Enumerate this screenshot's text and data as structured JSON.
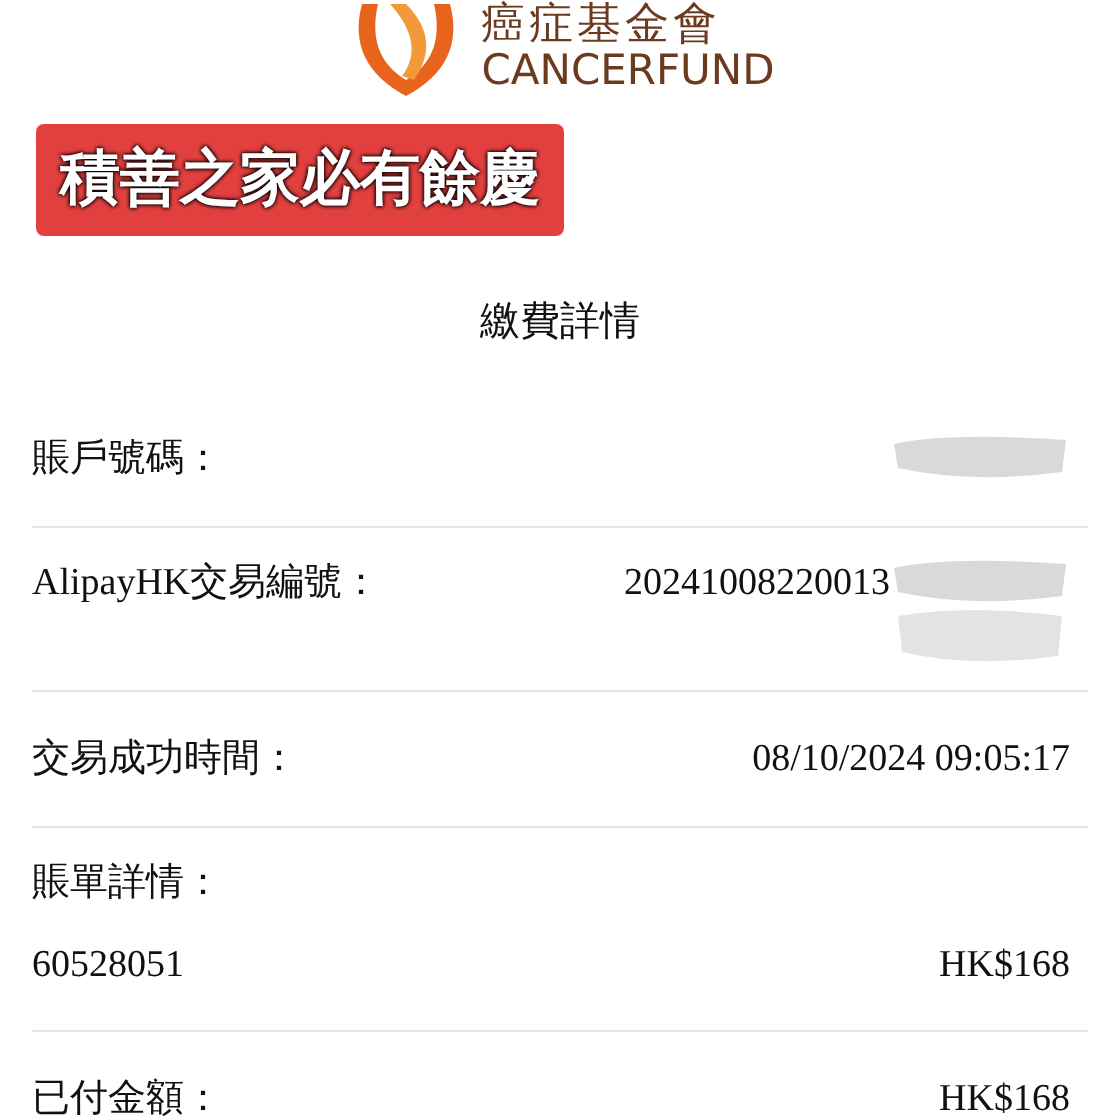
{
  "logo": {
    "name_zh": "癌症基金會",
    "name_en": "CANCERFUND"
  },
  "banner": {
    "text": "積善之家必有餘慶"
  },
  "title": "繳費詳情",
  "rows": [
    {
      "kind": "pair",
      "label": "賬戶號碼：",
      "redacted": true
    },
    {
      "kind": "pair",
      "label": "AlipayHK交易編號：",
      "value": "20241008220013",
      "redacted": true
    },
    {
      "kind": "pair",
      "label": "交易成功時間：",
      "value": "08/10/2024 09:05:17"
    },
    {
      "kind": "bill",
      "label": "賬單詳情：",
      "ref": "60528051",
      "value": "HK$168"
    },
    {
      "kind": "pair",
      "label": "已付金額：",
      "value": "HK$168"
    }
  ]
}
